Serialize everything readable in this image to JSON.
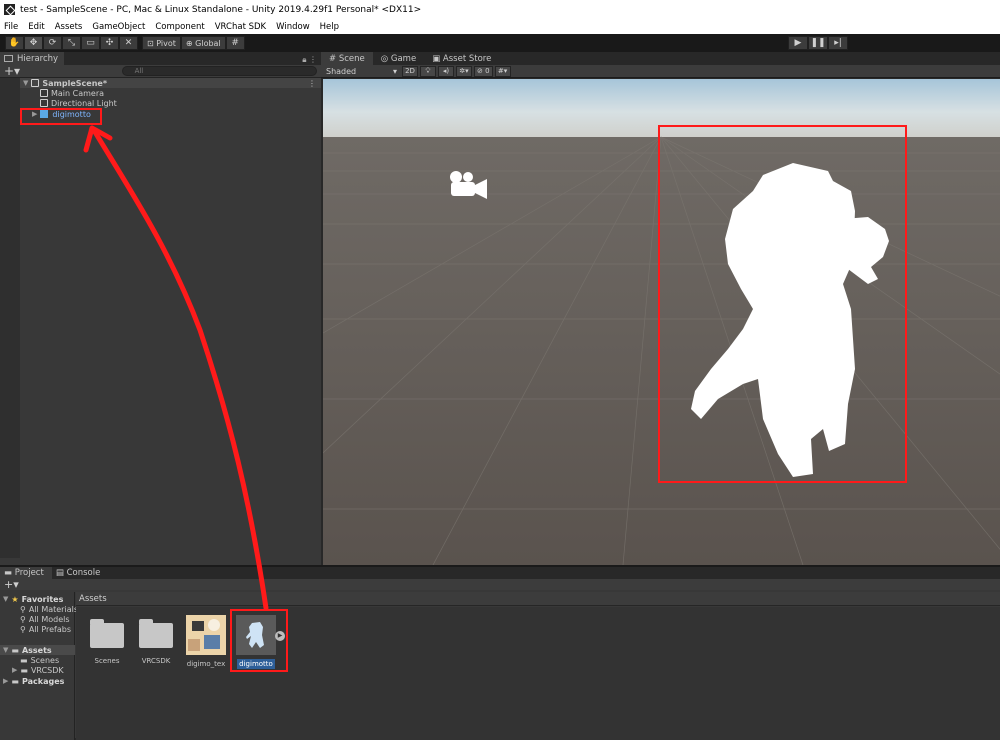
{
  "window": {
    "title": "test - SampleScene - PC, Mac & Linux Standalone - Unity 2019.4.29f1 Personal* <DX11>"
  },
  "menu": [
    "File",
    "Edit",
    "Assets",
    "GameObject",
    "Component",
    "VRChat SDK",
    "Window",
    "Help"
  ],
  "toolbar": {
    "pivot_label": "Pivot",
    "global_label": "Global"
  },
  "hierarchy": {
    "tab_label": "Hierarchy",
    "search_placeholder": "All",
    "scene_name": "SampleScene*",
    "items": [
      "Main Camera",
      "Directional Light",
      "digimotto"
    ]
  },
  "scene_view": {
    "tabs": [
      "Scene",
      "Game",
      "Asset Store"
    ],
    "shading_mode": "Shaded",
    "mode_2d": "2D",
    "hidden_count": "0"
  },
  "project": {
    "tabs": [
      "Project",
      "Console"
    ],
    "favorites_label": "Favorites",
    "favorites": [
      "All Materials",
      "All Models",
      "All Prefabs"
    ],
    "assets_label": "Assets",
    "asset_folders": [
      "Scenes",
      "VRCSDK"
    ],
    "packages_label": "Packages",
    "breadcrumb": "Assets",
    "items": [
      "Scenes",
      "VRCSDK",
      "digimo_tex",
      "digimotto"
    ]
  },
  "annotation": {
    "color": "#ff1a1a"
  }
}
